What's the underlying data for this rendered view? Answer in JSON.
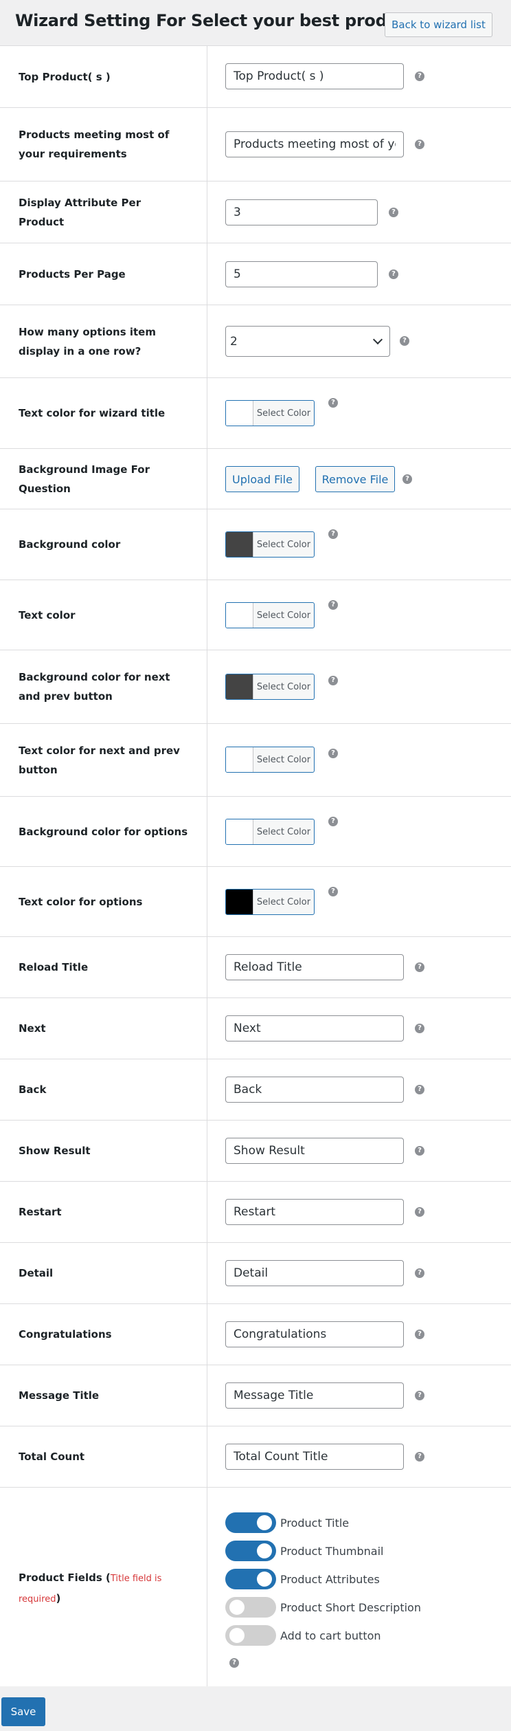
{
  "header": {
    "title": "Wizard Setting For Select your best product",
    "back_label": "Back to wizard list"
  },
  "help_glyph": "?",
  "rows": {
    "top_products": {
      "label": "Top Product( s )",
      "value": "Top Product( s )"
    },
    "products_meeting": {
      "label": "Products meeting most of your requirements",
      "value": "Products meeting most of your requirements"
    },
    "display_attribute": {
      "label": "Display Attribute Per Product",
      "value": "3"
    },
    "products_per_page": {
      "label": "Products Per Page",
      "value": "5"
    },
    "options_per_row": {
      "label": "How many options item display in a one row?",
      "selected": "2"
    },
    "title_color": {
      "label": "Text color for wizard title",
      "button": "Select Color",
      "color": "#ffffff"
    },
    "bg_image": {
      "label": "Background Image For Question",
      "upload": "Upload File",
      "remove": "Remove File"
    },
    "bg_color": {
      "label": "Background color",
      "button": "Select Color",
      "color": "#444444"
    },
    "text_color": {
      "label": "Text color",
      "button": "Select Color",
      "color": "#ffffff"
    },
    "nav_bg_color": {
      "label": "Background color for next and prev button",
      "button": "Select Color",
      "color": "#444444"
    },
    "nav_text_color": {
      "label": "Text color for next and prev button",
      "button": "Select Color",
      "color": "#ffffff"
    },
    "options_bg_color": {
      "label": "Background color for options",
      "button": "Select Color",
      "color": "#ffffff"
    },
    "options_text_color": {
      "label": "Text color for options",
      "button": "Select Color",
      "color": "#000000"
    },
    "reload_title": {
      "label": "Reload Title",
      "value": "Reload Title"
    },
    "next": {
      "label": "Next",
      "value": "Next"
    },
    "back": {
      "label": "Back",
      "value": "Back"
    },
    "show_result": {
      "label": "Show Result",
      "value": "Show Result"
    },
    "restart": {
      "label": "Restart",
      "value": "Restart"
    },
    "detail": {
      "label": "Detail",
      "value": "Detail"
    },
    "congratulations": {
      "label": "Congratulations",
      "value": "Congratulations"
    },
    "message_title": {
      "label": "Message Title",
      "value": "Message Title"
    },
    "total_count": {
      "label": "Total Count",
      "value": "Total Count Title"
    },
    "product_fields": {
      "label": "Product Fields (",
      "required": "Title field is required",
      "label_end": ")",
      "toggles": [
        {
          "label": "Product Title",
          "on": true
        },
        {
          "label": "Product Thumbnail",
          "on": true
        },
        {
          "label": "Product Attributes",
          "on": true
        },
        {
          "label": "Product Short Description",
          "on": false
        },
        {
          "label": "Add to cart button",
          "on": false
        }
      ]
    }
  },
  "footer": {
    "save_label": "Save"
  },
  "colors": {
    "accent": "#2271b1",
    "required": "#d63638"
  }
}
